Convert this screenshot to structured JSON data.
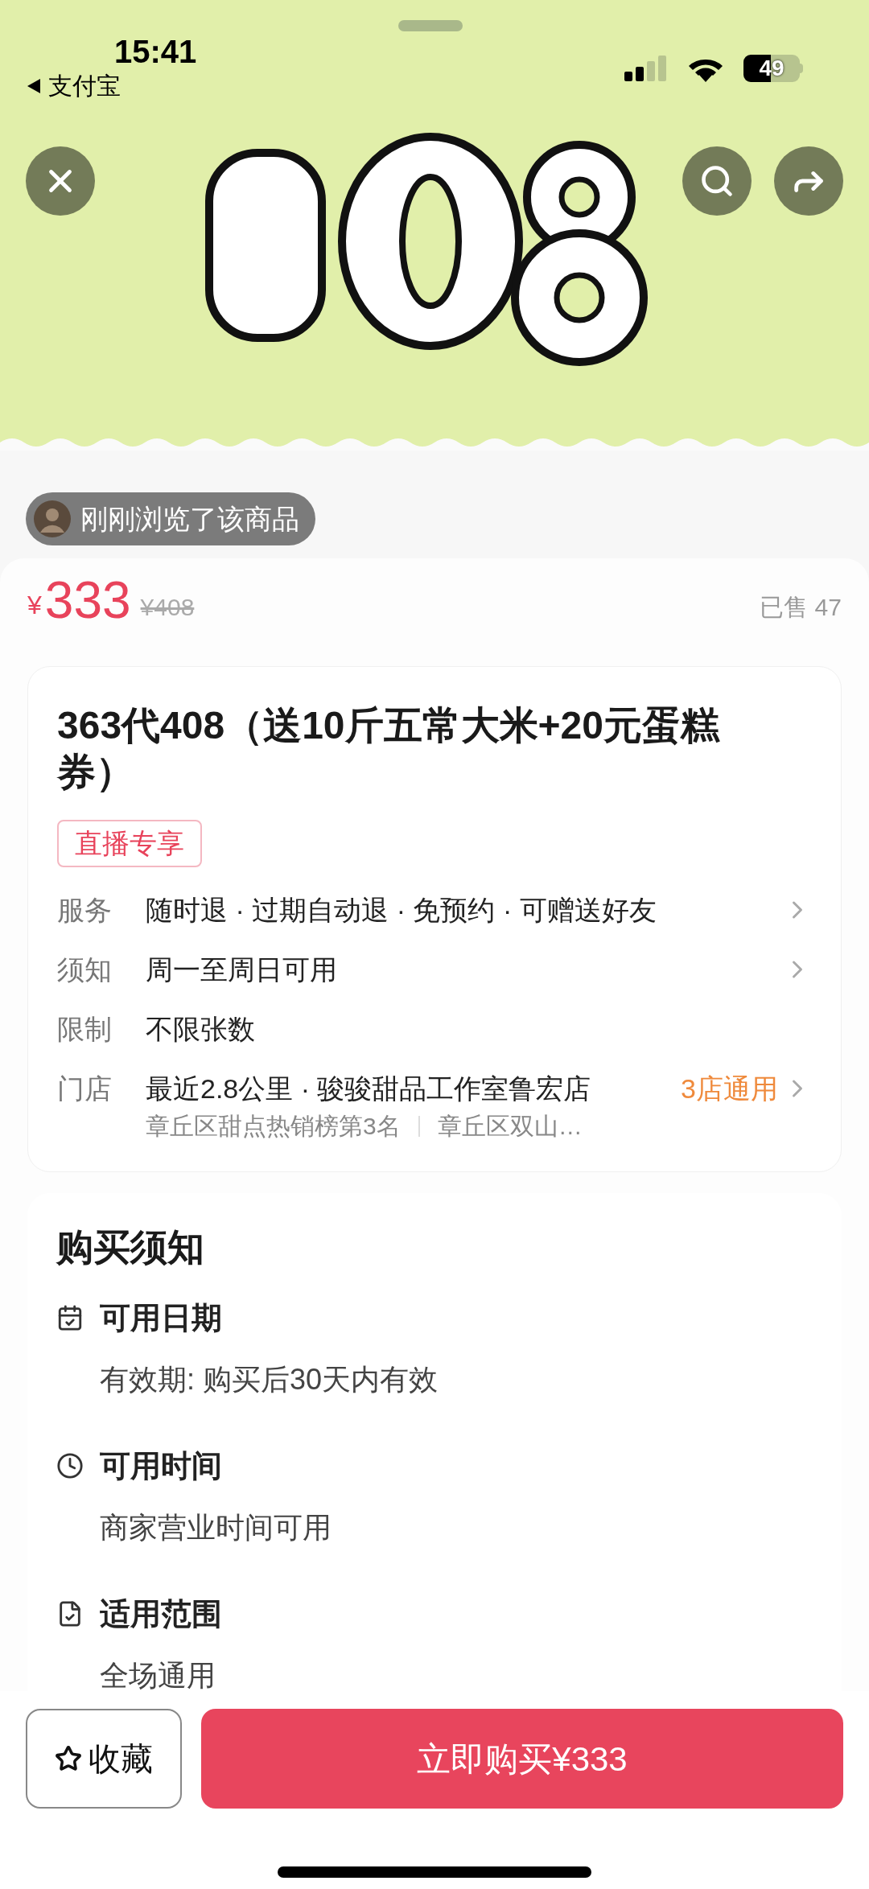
{
  "status_bar": {
    "time": "15:41",
    "back_app": "支付宝",
    "battery": "49"
  },
  "viewed_chip": {
    "text": "刚刚浏览了该商品"
  },
  "price": {
    "currency": "¥",
    "amount": "333",
    "original": "¥408",
    "sold": "已售 47"
  },
  "product": {
    "title": "363代408（送10斤五常大米+20元蛋糕券）",
    "tag": "直播专享",
    "rows": [
      {
        "label": "服务",
        "value": "随时退 · 过期自动退 · 免预约 · 可赠送好友",
        "chevron": true
      },
      {
        "label": "须知",
        "value": "周一至周日可用",
        "chevron": true
      },
      {
        "label": "限制",
        "value": "不限张数",
        "chevron": false
      },
      {
        "label": "门店",
        "value": "最近2.8公里 · 骏骏甜品工作室鲁宏店",
        "extra": "3店通用",
        "chevron": true,
        "sub": [
          "章丘区甜点热销榜第3名",
          "章丘区双山…"
        ]
      }
    ]
  },
  "notice": {
    "title": "购买须知",
    "items": [
      {
        "kind": "calendar",
        "title": "可用日期",
        "text": "有效期: 购买后30天内有效"
      },
      {
        "kind": "clock",
        "title": "可用时间",
        "text": "商家营业时间可用"
      },
      {
        "kind": "document",
        "title": "适用范围",
        "text": "全场通用"
      }
    ]
  },
  "bottom": {
    "favorite": "收藏",
    "buy": "立即购买¥333"
  }
}
